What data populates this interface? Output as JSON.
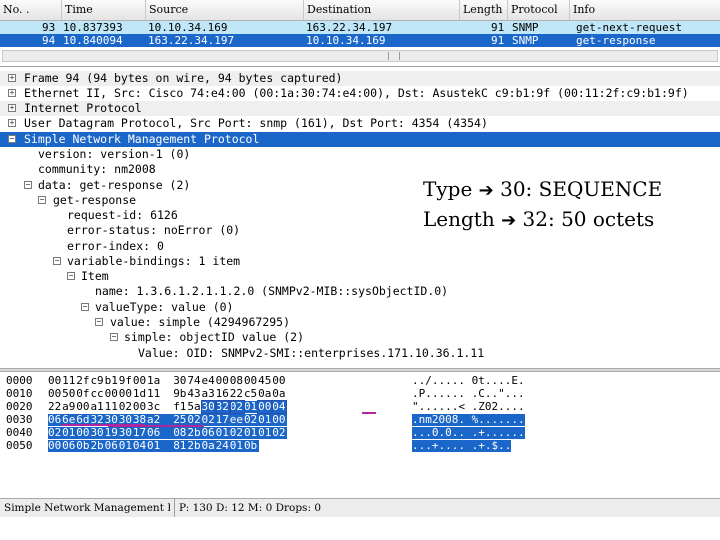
{
  "packet_list": {
    "columns": [
      "No. .",
      "Time",
      "Source",
      "Destination",
      "Length",
      "Protocol",
      "Info"
    ],
    "rows": [
      {
        "no": "93",
        "time": "10.837393",
        "source": "10.10.34.169",
        "destination": "163.22.34.197",
        "length": "91",
        "protocol": "SNMP",
        "info": "get-next-request"
      },
      {
        "no": "94",
        "time": "10.840094",
        "source": "163.22.34.197",
        "destination": "10.10.34.169",
        "length": "91",
        "protocol": "SNMP",
        "info": "get-response"
      }
    ]
  },
  "details": {
    "rows": [
      {
        "text": "Frame 94 (94 bytes on wire, 94 bytes captured)",
        "box": "+"
      },
      {
        "text": "Ethernet II, Src: Cisco 74:e4:00 (00:1a:30:74:e4:00), Dst: AsustekC c9:b1:9f (00:11:2f:c9:b1:9f)",
        "box": "+"
      },
      {
        "text": "Internet Protocol",
        "box": "+"
      },
      {
        "text": "User Datagram Protocol, Src Port: snmp (161), Dst Port: 4354 (4354)",
        "box": "+"
      },
      {
        "text": "Simple Network Management Protocol",
        "box": "−"
      },
      {
        "text": "version: version-1 (0)",
        "box": ""
      },
      {
        "text": "community: nm2008",
        "box": ""
      },
      {
        "text": "data: get-response (2)",
        "box": "−"
      },
      {
        "text": "get-response",
        "box": "−"
      },
      {
        "text": "request-id: 6126",
        "box": ""
      },
      {
        "text": "error-status: noError (0)",
        "box": ""
      },
      {
        "text": "error-index: 0",
        "box": ""
      },
      {
        "text": "variable-bindings: 1 item",
        "box": "−"
      },
      {
        "text": "Item",
        "box": "−"
      },
      {
        "text": "name: 1.3.6.1.2.1.1.2.0 (SNMPv2-MIB::sysObjectID.0)",
        "box": ""
      },
      {
        "text": "valueType: value (0)",
        "box": "−"
      },
      {
        "text": "value: simple (4294967295)",
        "box": "−"
      },
      {
        "text": "simple: objectID value (2)",
        "box": "−"
      },
      {
        "text": "Value: OID: SNMPv2-SMI::enterprises.171.10.36.1.11",
        "box": ""
      }
    ]
  },
  "annotation": {
    "line1": {
      "label": "Type",
      "value": "30: SEQUENCE"
    },
    "line2": {
      "label": "Length",
      "value": "32:  50 octets"
    },
    "arrow": "➔"
  },
  "hex_dump": {
    "rows": [
      {
        "offset": "0000",
        "bytes": [
          "00",
          "11",
          "2f",
          "c9",
          "b1",
          "9f",
          "00",
          "1a",
          "30",
          "74",
          "e4",
          "00",
          "08",
          "00",
          "45",
          "00"
        ],
        "ascii": "../..... 0t....E."
      },
      {
        "offset": "0010",
        "bytes": [
          "00",
          "50",
          "0f",
          "cc",
          "00",
          "00",
          "1d",
          "11",
          "9b",
          "43",
          "a3",
          "16",
          "22",
          "c5",
          "0a",
          "0a"
        ],
        "ascii": ".P...... .C..\"..."
      },
      {
        "offset": "0020",
        "bytes": [
          "22",
          "a9",
          "00",
          "a1",
          "11",
          "02",
          "00",
          "3c",
          "f1",
          "5a",
          "30",
          "32",
          "02",
          "01",
          "00",
          "04"
        ],
        "ascii": "\"......< .Z02...."
      },
      {
        "offset": "0030",
        "bytes": [
          "06",
          "6e",
          "6d",
          "32",
          "30",
          "30",
          "38",
          "a2",
          "25",
          "02",
          "02",
          "17",
          "ee",
          "02",
          "01",
          "00"
        ],
        "ascii": ".nm2008. %......."
      },
      {
        "offset": "0040",
        "bytes": [
          "02",
          "01",
          "00",
          "30",
          "19",
          "30",
          "17",
          "06",
          "08",
          "2b",
          "06",
          "01",
          "02",
          "01",
          "01",
          "02"
        ],
        "ascii": "...0.0.. .+......"
      },
      {
        "offset": "0050",
        "bytes": [
          "00",
          "06",
          "0b",
          "2b",
          "06",
          "01",
          "04",
          "01",
          "81",
          "2b",
          "0a",
          "24",
          "01",
          "0b"
        ],
        "ascii": "...+.... .+.$.."
      }
    ]
  },
  "status_bar": {
    "field": "Simple Network Management Prot··",
    "counts": "P: 130 D: 12 M: 0 Drops: 0"
  }
}
